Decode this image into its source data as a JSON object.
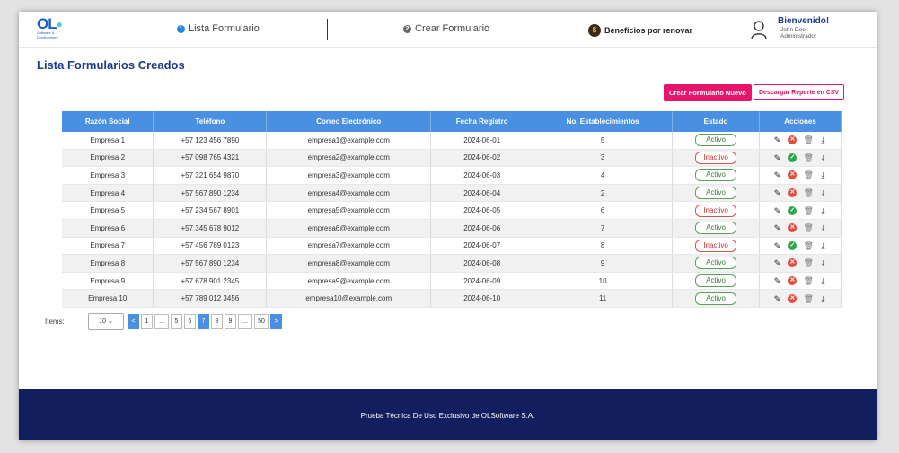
{
  "logo": {
    "mark": "OL",
    "line1": "Software &",
    "line2": "Development"
  },
  "nav": {
    "step1_num": "1",
    "step1": "Lista Formulario",
    "step2_num": "2",
    "step2": "Crear Formulario",
    "benefits": "Beneficios por renovar"
  },
  "user": {
    "greeting": "Bienvenido!",
    "name": "John Doe",
    "role": "Administrador"
  },
  "page_title": "Lista Formularios Creados",
  "buttons": {
    "new_form": "Crear Formulario Nuevo",
    "csv": "Descargar Reporte en CSV"
  },
  "table": {
    "headers": [
      "Razón Social",
      "Teléfono",
      "Correo Electrónico",
      "Fecha Registro",
      "No. Establecimientos",
      "Estado",
      "Acciones"
    ],
    "rows": [
      {
        "company": "Empresa 1",
        "phone": "+57 123 456 7890",
        "email": "empresa1@example.com",
        "date": "2024-06-01",
        "count": "5",
        "status": "Activo"
      },
      {
        "company": "Empresa 2",
        "phone": "+57 098 765 4321",
        "email": "empresa2@example.com",
        "date": "2024-06-02",
        "count": "3",
        "status": "Inactivo"
      },
      {
        "company": "Empresa 3",
        "phone": "+57 321 654 9870",
        "email": "empresa3@example.com",
        "date": "2024-06-03",
        "count": "4",
        "status": "Activo"
      },
      {
        "company": "Empresa 4",
        "phone": "+57 567 890 1234",
        "email": "empresa4@example.com",
        "date": "2024-06-04",
        "count": "2",
        "status": "Activo"
      },
      {
        "company": "Empresa 5",
        "phone": "+57 234 567 8901",
        "email": "empresa5@example.com",
        "date": "2024-06-05",
        "count": "6",
        "status": "Inactivo"
      },
      {
        "company": "Empresa 6",
        "phone": "+57 345 678 9012",
        "email": "empresa6@example.com",
        "date": "2024-06-06",
        "count": "7",
        "status": "Activo"
      },
      {
        "company": "Empresa 7",
        "phone": "+57 456 789 0123",
        "email": "empresa7@example.com",
        "date": "2024-06-07",
        "count": "8",
        "status": "Inactivo"
      },
      {
        "company": "Empresa 8",
        "phone": "+57 567 890 1234",
        "email": "empresa8@example.com",
        "date": "2024-06-08",
        "count": "9",
        "status": "Activo"
      },
      {
        "company": "Empresa 9",
        "phone": "+57 678 901 2345",
        "email": "empresa9@example.com",
        "date": "2024-06-09",
        "count": "10",
        "status": "Activo"
      },
      {
        "company": "Empresa 10",
        "phone": "+57 789 012 3456",
        "email": "empresa10@example.com",
        "date": "2024-06-10",
        "count": "11",
        "status": "Activo"
      }
    ]
  },
  "pagination": {
    "items_label": "Items:",
    "items_value": "10",
    "pages": [
      "<",
      "1",
      "...",
      "5",
      "6",
      "7",
      "8",
      "9",
      "...",
      "50",
      ">"
    ],
    "active": "7"
  },
  "footer": "Prueba Técnica De Uso Exclusivo de OLSoftware S.A.",
  "icons": [
    "edit-icon",
    "toggle-status-icon",
    "trash-icon",
    "download-icon",
    "user-avatar-icon",
    "coin-icon"
  ],
  "colors": {
    "primary": "#1e3a8a",
    "accent": "#e6156b",
    "header": "#4a90e2",
    "footer": "#121e5e",
    "active": "#2ea64a",
    "inactive": "#e24c3c"
  }
}
